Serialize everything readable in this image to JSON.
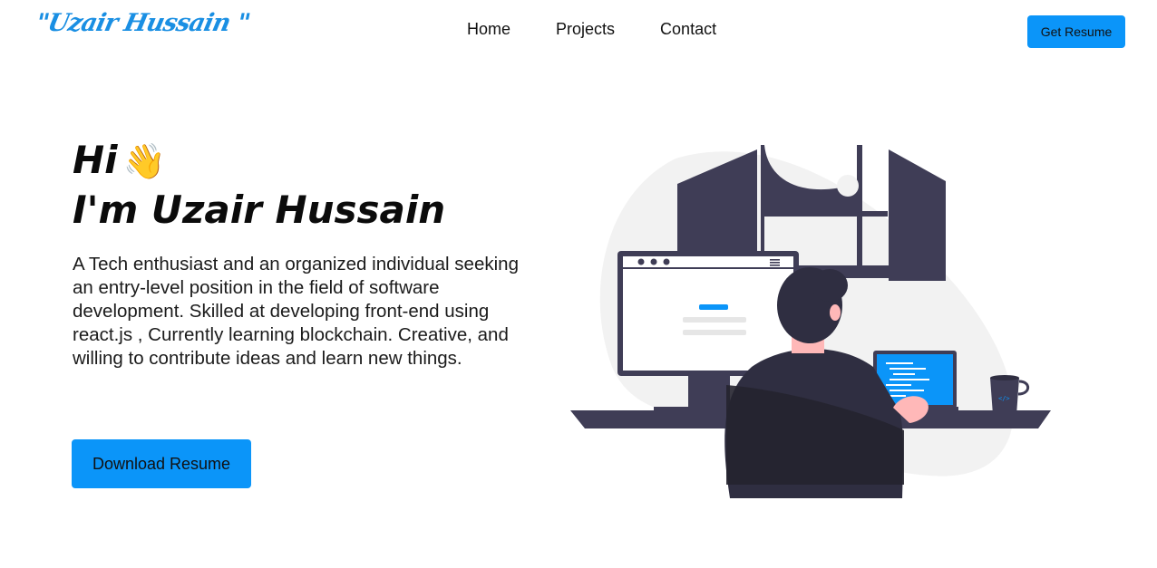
{
  "header": {
    "logo": "\"Uzair Hussain \"",
    "nav": [
      "Home",
      "Projects",
      "Contact"
    ],
    "resume_button": "Get Resume"
  },
  "hero": {
    "greeting": "Hi",
    "wave_emoji": "👋",
    "headline": "I'm Uzair Hussain",
    "description": "A Tech enthusiast and an organized individual seeking an entry-level position in the field of software development. Skilled at developing front-end using react.js , Currently learning blockchain. Creative, and willing to contribute ideas and learn new things.",
    "download_button": "Download Resume"
  },
  "colors": {
    "accent": "#0b95f9",
    "logo": "#1a8fe3",
    "illustration_dark": "#3f3d56",
    "illustration_blob": "#f2f2f2"
  }
}
